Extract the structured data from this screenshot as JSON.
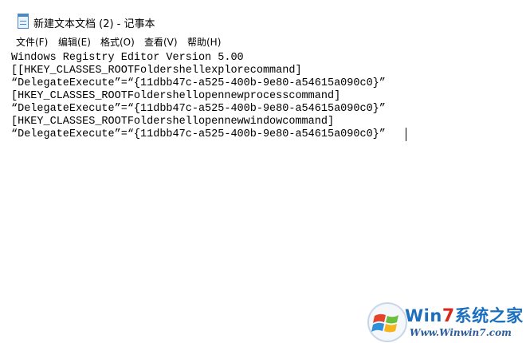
{
  "window": {
    "title": "新建文本文档 (2) - 记事本"
  },
  "menu": [
    {
      "label": "文件(F)"
    },
    {
      "label": "编辑(E)"
    },
    {
      "label": "格式(O)"
    },
    {
      "label": "查看(V)"
    },
    {
      "label": "帮助(H)"
    }
  ],
  "editor": {
    "lines": [
      "Windows Registry Editor Version 5.00",
      "[[HKEY_CLASSES_ROOTFoldershellexplorecommand]",
      "“DelegateExecute”=“{11dbb47c-a525-400b-9e80-a54615a090c0}”",
      "[HKEY_CLASSES_ROOTFoldershellopennewprocesscommand]",
      "“DelegateExecute”=“{11dbb47c-a525-400b-9e80-a54615a090c0}”",
      "[HKEY_CLASSES_ROOTFoldershellopennewwindowcommand]",
      "“DelegateExecute”=“{11dbb47c-a525-400b-9e80-a54615a090c0}”"
    ]
  },
  "watermark": {
    "brand_w": "W",
    "brand_in": "in",
    "brand_7": "7",
    "brand_cn": "系统之家",
    "url": "Www.Winwin7.com"
  },
  "icons": {
    "app": "notepad-icon",
    "watermark_logo": "windows-logo-icon"
  },
  "colors": {
    "brand_blue": "#1b6fbf",
    "brand_red": "#d42a1f"
  }
}
